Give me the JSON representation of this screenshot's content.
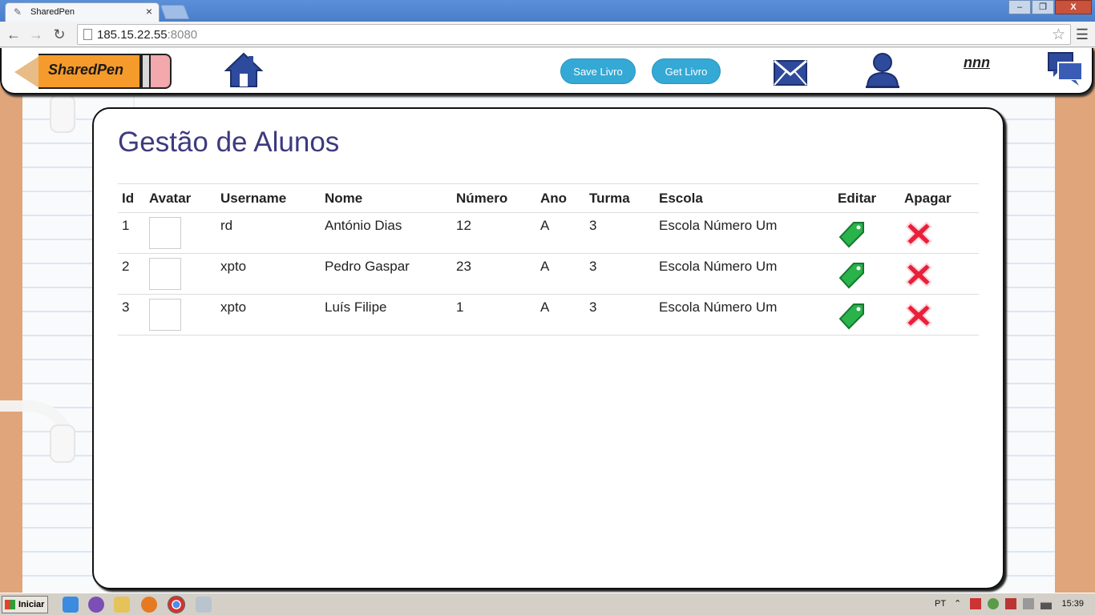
{
  "browser": {
    "tab_title": "SharedPen",
    "tab_close": "×",
    "url_host": "185.15.22.55",
    "url_port": ":8080",
    "window_buttons": [
      "–",
      "❐",
      "X"
    ]
  },
  "header": {
    "logo_text": "SharedPen",
    "save_button": "Save Livro",
    "get_button": "Get Livro",
    "username": "nnn"
  },
  "main": {
    "title": "Gestão de Alunos",
    "columns": [
      "Id",
      "Avatar",
      "Username",
      "Nome",
      "Número",
      "Ano",
      "Turma",
      "Escola",
      "Editar",
      "Apagar"
    ],
    "rows": [
      {
        "id": "1",
        "username": "rd",
        "nome": "António Dias",
        "numero": "12",
        "ano": "A",
        "turma": "3",
        "escola": "Escola Número Um"
      },
      {
        "id": "2",
        "username": "xpto",
        "nome": "Pedro Gaspar",
        "numero": "23",
        "ano": "A",
        "turma": "3",
        "escola": "Escola Número Um"
      },
      {
        "id": "3",
        "username": "xpto",
        "nome": "Luís Filipe",
        "numero": "1",
        "ano": "A",
        "turma": "3",
        "escola": "Escola Número Um"
      }
    ]
  },
  "taskbar": {
    "start_label": "Iniciar",
    "language": "PT",
    "time": "15:39"
  },
  "colors": {
    "title": "#3d3a7e",
    "pill_button": "#34a9d6",
    "edit_green": "#2ab24b",
    "delete_red": "#e8203a",
    "notebook_border": "#e0a57a"
  }
}
